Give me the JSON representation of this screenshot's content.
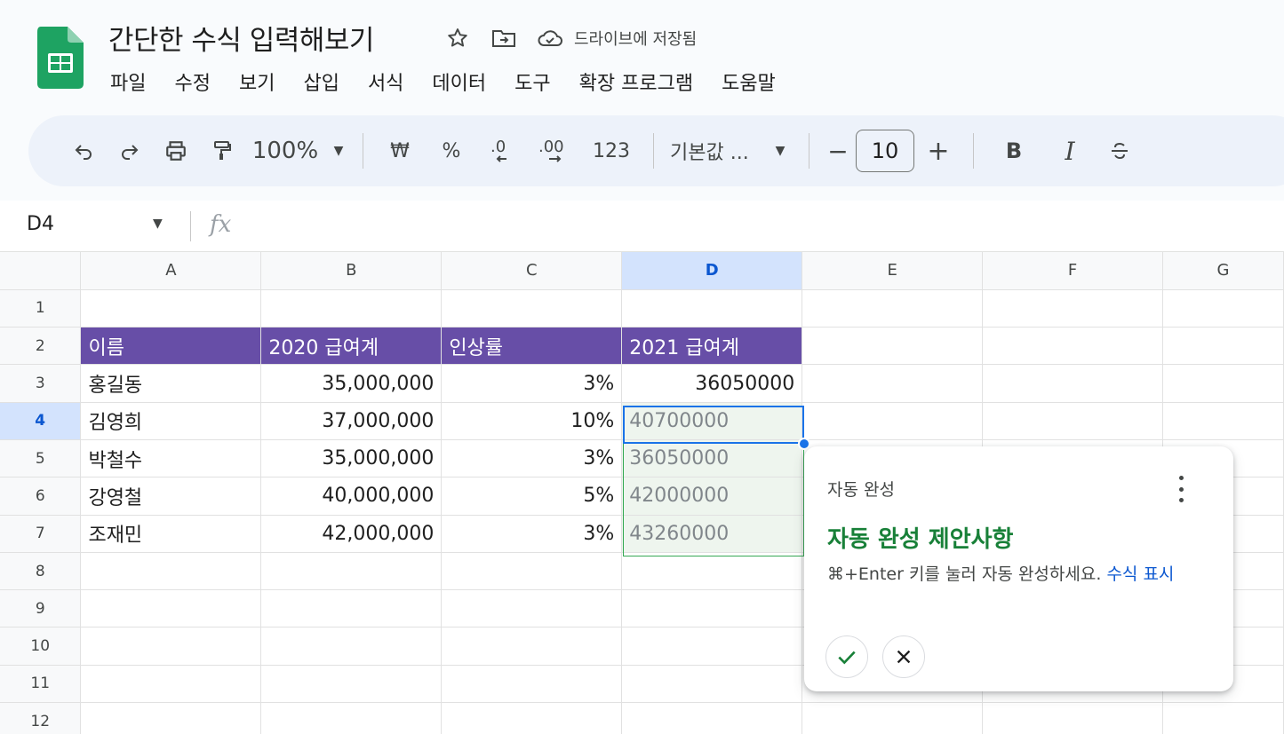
{
  "doc": {
    "title": "간단한 수식 입력해보기",
    "save_status": "드라이브에 저장됨"
  },
  "menu": [
    "파일",
    "수정",
    "보기",
    "삽입",
    "서식",
    "데이터",
    "도구",
    "확장 프로그램",
    "도움말"
  ],
  "toolbar": {
    "zoom": "100%",
    "currency": "₩",
    "percent": "%",
    "dec_decrease": ".0",
    "dec_increase": ".00",
    "number_format": "123",
    "font_name": "기본값 ...",
    "font_size": "10",
    "minus": "−",
    "plus": "+",
    "bold": "B",
    "italic": "I"
  },
  "formula_bar": {
    "name_box": "D4",
    "fx": "fx"
  },
  "sheet": {
    "columns": [
      "A",
      "B",
      "C",
      "D",
      "E",
      "F",
      "G"
    ],
    "selected_column": "D",
    "selected_row": "4",
    "rows": [
      {
        "num": "1",
        "cells": [
          "",
          "",
          "",
          ""
        ]
      },
      {
        "num": "2",
        "cells": [
          "이름",
          "2020 급여계",
          "인상률",
          "2021 급여계"
        ]
      },
      {
        "num": "3",
        "cells": [
          "홍길동",
          "35,000,000",
          "3%",
          "36050000"
        ]
      },
      {
        "num": "4",
        "cells": [
          "김영희",
          "37,000,000",
          "10%",
          "40700000"
        ]
      },
      {
        "num": "5",
        "cells": [
          "박철수",
          "35,000,000",
          "3%",
          "36050000"
        ]
      },
      {
        "num": "6",
        "cells": [
          "강영철",
          "40,000,000",
          "5%",
          "42000000"
        ]
      },
      {
        "num": "7",
        "cells": [
          "조재민",
          "42,000,000",
          "3%",
          "43260000"
        ]
      },
      {
        "num": "8",
        "cells": [
          "",
          "",
          "",
          ""
        ]
      },
      {
        "num": "9",
        "cells": [
          "",
          "",
          "",
          ""
        ]
      },
      {
        "num": "10",
        "cells": [
          "",
          "",
          "",
          ""
        ]
      },
      {
        "num": "11",
        "cells": [
          "",
          "",
          "",
          ""
        ]
      },
      {
        "num": "12",
        "cells": [
          "",
          "",
          "",
          ""
        ]
      }
    ]
  },
  "autocomplete": {
    "header": "자동 완성",
    "title": "자동 완성 제안사항",
    "description": "⌘+Enter 키를 눌러 자동 완성하세요.",
    "link": "수식 표시"
  },
  "colors": {
    "header_fill": "#674ea7",
    "suggestion_green": "#188038",
    "selection_blue": "#1a73e8"
  }
}
